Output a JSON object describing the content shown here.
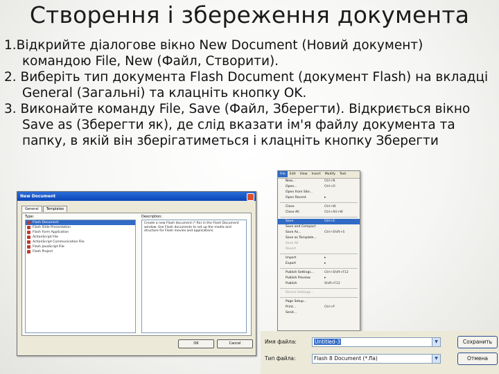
{
  "slide": {
    "title": "Створення і збереження документа",
    "steps": [
      {
        "text": "1.Відкрийте діалогове вікно New Document (Новий документ) командою File, New  (Файл, Створити)."
      },
      {
        "text": "2. Виберіть тип документа Flash Document (документ Flash) на вкладці General (Загальні) та клацніть кнопку OK."
      },
      {
        "text": "3. Виконайте команду File, Save (Файл, Зберегти). Відкриється вікно Save as (Зберегти як), де слід вказати ім'я файлу документа та папку, в якій він зберігатиметься і клацніть кнопку Зберегти"
      }
    ]
  },
  "new_document_dialog": {
    "title": "New Document",
    "tabs": [
      "General",
      "Templates"
    ],
    "type_label": "Type:",
    "description_label": "Description:",
    "types": [
      "Flash Document",
      "Flash Slide Presentation",
      "Flash Form Application",
      "ActionScript File",
      "ActionScript Communication File",
      "Flash JavaScript File",
      "Flash Project"
    ],
    "selected_type_index": 0,
    "description": "Create a new Flash document (*.fla) in the Flash Document window. Use Flash documents to set up the media and structure for Flash movies and applications.",
    "ok_label": "OK",
    "cancel_label": "Cancel",
    "colors": {
      "selection": "#316ac5",
      "title_bar": "#0a46b8"
    }
  },
  "file_menu": {
    "menubar": [
      "File",
      "Edit",
      "View",
      "Insert",
      "Modify",
      "Text"
    ],
    "open_menu": "File",
    "items": [
      {
        "label": "New...",
        "shortcut": "Ctrl+N"
      },
      {
        "label": "Open...",
        "shortcut": "Ctrl+O"
      },
      {
        "label": "Open from Site...",
        "shortcut": ""
      },
      {
        "label": "Open Recent",
        "shortcut": "▸"
      },
      {
        "label": "Close",
        "shortcut": "Ctrl+W"
      },
      {
        "label": "Close All",
        "shortcut": "Ctrl+Alt+W"
      },
      {
        "label": "Save",
        "shortcut": "Ctrl+S"
      },
      {
        "label": "Save and Compact",
        "shortcut": ""
      },
      {
        "label": "Save As...",
        "shortcut": "Ctrl+Shift+S"
      },
      {
        "label": "Save as Template...",
        "shortcut": ""
      },
      {
        "label": "Save All",
        "shortcut": ""
      },
      {
        "label": "Revert",
        "shortcut": ""
      },
      {
        "label": "Import",
        "shortcut": "▸"
      },
      {
        "label": "Export",
        "shortcut": "▸"
      },
      {
        "label": "Publish Settings...",
        "shortcut": "Ctrl+Shift+F12"
      },
      {
        "label": "Publish Preview",
        "shortcut": "▸"
      },
      {
        "label": "Publish",
        "shortcut": "Shift+F12"
      },
      {
        "label": "Device Settings...",
        "shortcut": ""
      },
      {
        "label": "Page Setup...",
        "shortcut": ""
      },
      {
        "label": "Print...",
        "shortcut": "Ctrl+P"
      },
      {
        "label": "Send...",
        "shortcut": ""
      }
    ],
    "selected_item": "Save"
  },
  "save_as": {
    "filename_label": "Имя файла:",
    "filename_value": "Untitled-3",
    "filetype_label": "Тип файла:",
    "filetype_value": "Flash 8 Document (*.fla)",
    "save_button": "Сохранить",
    "cancel_button": "Отмена"
  }
}
